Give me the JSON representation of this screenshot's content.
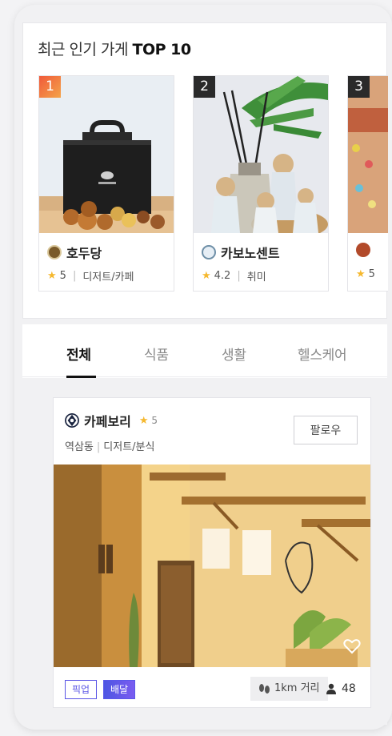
{
  "top10": {
    "title_prefix": "최근 인기 가게 ",
    "title_bold": "TOP 10",
    "cards": [
      {
        "rank": "1",
        "name": "호두당",
        "rating": "5",
        "category": "디저트/카페"
      },
      {
        "rank": "2",
        "name": "카보노센트",
        "rating": "4.2",
        "category": "취미"
      },
      {
        "rank": "3",
        "name": "",
        "rating": "5",
        "category": ""
      }
    ]
  },
  "tabs": [
    {
      "label": "전체",
      "active": true
    },
    {
      "label": "식품",
      "active": false
    },
    {
      "label": "생활",
      "active": false
    },
    {
      "label": "헬스케어",
      "active": false
    }
  ],
  "post": {
    "name": "카페보리",
    "rating": "5",
    "location": "역삼동",
    "category": "디저트/분식",
    "follow_label": "팔로우",
    "chips": {
      "pickup": "픽업",
      "delivery": "배달"
    },
    "distance": "1km 거리",
    "followers": "48"
  },
  "colors": {
    "accent": "#5a55e6",
    "rank1": "#f05a3a",
    "star": "#f5b82e"
  },
  "icons": [
    "star-icon",
    "heart-icon",
    "footprint-icon",
    "person-icon"
  ]
}
